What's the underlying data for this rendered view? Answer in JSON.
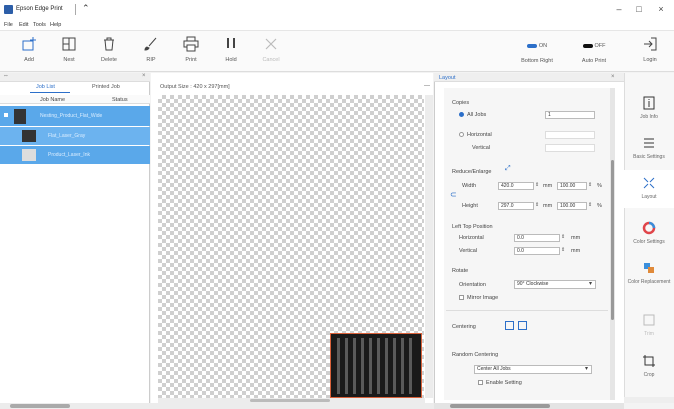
{
  "app": {
    "title": "Epson Edge Print"
  },
  "menu": [
    "File",
    "Edit",
    "Tools",
    "Help"
  ],
  "toolbar": {
    "add": "Add",
    "nest": "Nest",
    "delete": "Delete",
    "rip": "RIP",
    "print": "Print",
    "hold": "Hold",
    "cancel": "Cancel",
    "bottom_right_state": "ON",
    "bottom_right": "Bottom Right",
    "auto_print_state": "OFF",
    "auto_print": "Auto Print",
    "login": "Login"
  },
  "left_panel": {
    "tab_job_list": "Job List",
    "tab_printed_job": "Printed Job",
    "col_job_name": "Job Name",
    "col_status": "Status",
    "jobs": [
      {
        "name": "Nesting_Product_Flat_Wide"
      },
      {
        "name": "Flat_Laser_Gray"
      },
      {
        "name": "Product_Laser_Ink"
      }
    ]
  },
  "canvas": {
    "size_label": "Output Size : 420 x 297[mm]"
  },
  "layout": {
    "title": "Layout",
    "copies_label": "Copies",
    "all_jobs": "All Jobs",
    "horizontal": "Horizontal",
    "vertical": "Vertical",
    "copies_value": "1",
    "reduce_enlarge": "Reduce/Enlarge",
    "width_label": "Width",
    "width_value": "420.0",
    "height_label": "Height",
    "height_value": "297.0",
    "unit_mm": "mm",
    "scale_w": "100.00",
    "scale_h": "100.00",
    "percent": "%",
    "left_top_position": "Left Top Position",
    "pos_horizontal": "Horizontal",
    "pos_vertical": "Vertical",
    "pos_h_value": "0.0",
    "pos_v_value": "0.0",
    "rotate": "Rotate",
    "orientation": "Orientation",
    "orientation_value": "90° Clockwise",
    "mirror_image": "Mirror Image",
    "centering": "Centering",
    "random_centering": "Random Centering",
    "center_all_jobs": "Center All Jobs",
    "enable_setting": "Enable Setting"
  },
  "side_tabs": {
    "job_info": "Job Info",
    "basic_settings": "Basic Settings",
    "layout": "Layout",
    "color_settings": "Color Settings",
    "color_replacement": "Color Replacement",
    "trim": "Trim",
    "crop": "Crop"
  },
  "colors": {
    "accent": "#2c6fc9",
    "selection": "#5aa8ea",
    "image_border": "#d9613a"
  }
}
